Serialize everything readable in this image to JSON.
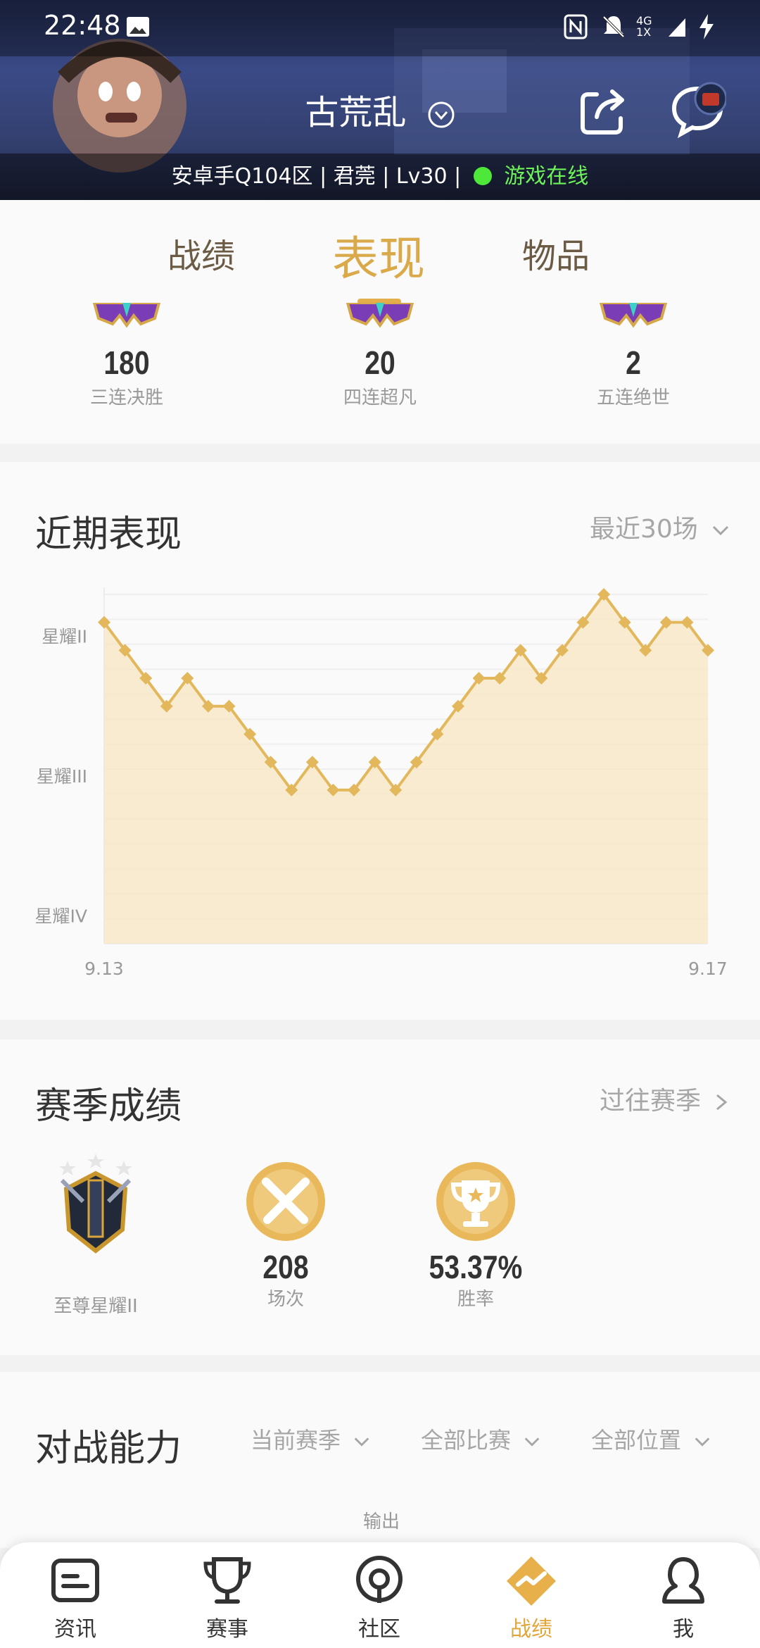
{
  "status_bar": {
    "time": "22:48",
    "network": "4G 1X"
  },
  "header": {
    "game_title": "古荒乱",
    "account_info": "安卓手Q104区 | 君莞 | Lv30 |",
    "online_status": "游戏在线"
  },
  "tabs": [
    {
      "label": "战绩",
      "active": false
    },
    {
      "label": "表现",
      "active": true
    },
    {
      "label": "物品",
      "active": false
    }
  ],
  "multi_kills": [
    {
      "value": "180",
      "label": "三连决胜"
    },
    {
      "value": "20",
      "label": "四连超凡"
    },
    {
      "value": "2",
      "label": "五连绝世"
    }
  ],
  "recent_performance": {
    "title": "近期表现",
    "filter": "最近30场",
    "chart_data": {
      "type": "area",
      "x_start_label": "9.13",
      "x_end_label": "9.17",
      "y_tick_labels": [
        "星耀II",
        "星耀III",
        "星耀IV"
      ],
      "y_ticks": [
        20,
        10,
        0
      ],
      "ylim": [
        -2,
        23
      ],
      "grid": true,
      "color": "#e3b85d",
      "fill_color": "#f7e6c2",
      "values": [
        21,
        19,
        17,
        15,
        17,
        15,
        15,
        13,
        11,
        9,
        11,
        9,
        9,
        11,
        9,
        11,
        13,
        15,
        17,
        17,
        19,
        17,
        19,
        21,
        23,
        21,
        19,
        21,
        21,
        19
      ]
    }
  },
  "season": {
    "title": "赛季成绩",
    "link": "过往赛季",
    "rank_label": "至尊星耀II",
    "matches_value": "208",
    "matches_label": "场次",
    "win_rate_value": "53.37%",
    "win_rate_label": "胜率"
  },
  "ability": {
    "title": "对战能力",
    "filters": [
      "当前赛季",
      "全部比赛",
      "全部位置"
    ],
    "partial_label": "输出"
  },
  "bottom_nav": [
    {
      "label": "资讯",
      "icon": "news-icon"
    },
    {
      "label": "赛事",
      "icon": "trophy-icon"
    },
    {
      "label": "社区",
      "icon": "community-icon"
    },
    {
      "label": "战绩",
      "icon": "stats-icon",
      "active": true
    },
    {
      "label": "我",
      "icon": "profile-icon"
    }
  ]
}
